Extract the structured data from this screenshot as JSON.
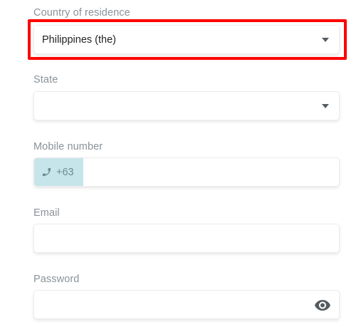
{
  "form": {
    "country": {
      "label": "Country of residence",
      "value": "Philippines (the)",
      "icon": "chevron-down-icon",
      "highlight_color": "#ff0000"
    },
    "state": {
      "label": "State",
      "value": "",
      "icon": "chevron-down-icon"
    },
    "mobile": {
      "label": "Mobile number",
      "prefix_icon": "phone-icon",
      "country_code": "+63",
      "value": "",
      "prefix_color": "#c6e5ea"
    },
    "email": {
      "label": "Email",
      "value": ""
    },
    "password": {
      "label": "Password",
      "value": "",
      "toggle_icon": "eye-icon"
    }
  }
}
